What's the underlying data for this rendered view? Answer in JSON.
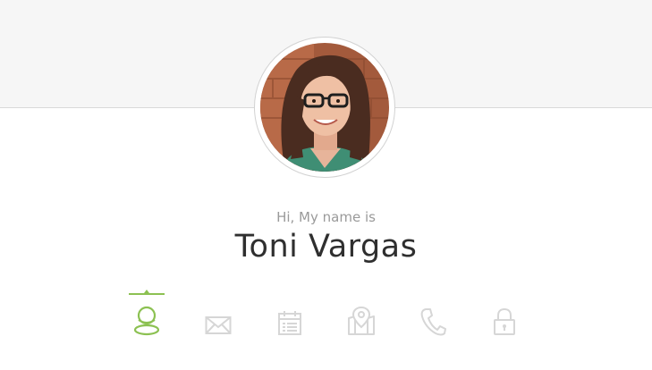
{
  "profile": {
    "intro": "Hi, My name is",
    "name": "Toni Vargas"
  },
  "tabs": [
    {
      "icon": "user-icon",
      "active": true
    },
    {
      "icon": "envelope-icon",
      "active": false
    },
    {
      "icon": "calendar-icon",
      "active": false
    },
    {
      "icon": "map-pin-icon",
      "active": false
    },
    {
      "icon": "phone-icon",
      "active": false
    },
    {
      "icon": "lock-icon",
      "active": false
    }
  ],
  "colors": {
    "accent": "#8cc152",
    "icon_inactive": "#d6d6d6",
    "name_text": "#2f2f2f",
    "intro_text": "#9a9a9a",
    "band": "#f6f6f6"
  }
}
